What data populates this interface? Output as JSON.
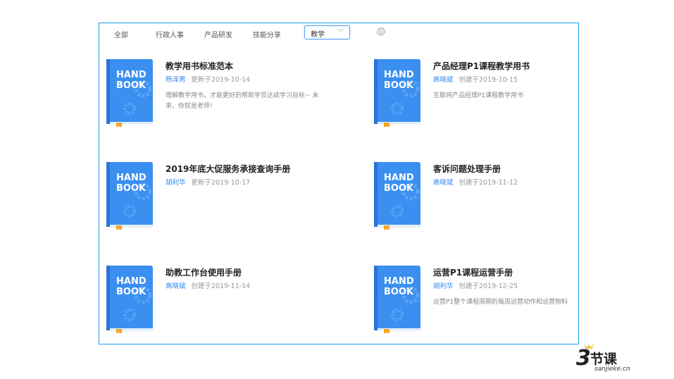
{
  "nav": {
    "tabs": [
      "全部",
      "行政人事",
      "产品研发",
      "技能分享"
    ],
    "select_value": "教学"
  },
  "book_cover": {
    "line1": "HAND",
    "line2": "BOOK"
  },
  "colors": {
    "accent": "#2f86f0",
    "border": "#1a9cf0",
    "book": "#3a8ff0",
    "bookmark": "#f5a623"
  },
  "cards": [
    {
      "title": "教学用书标准范本",
      "author": "杨泽男",
      "date": "更新于2019-10-14",
      "desc": "理解教学用书，才能更好的帮助学员达成学习目标~ 未来，你就是老师!"
    },
    {
      "title": "产品经理P1课程教学用书",
      "author": "高晓斌",
      "date": "创建于2019-10-15",
      "desc": "互联网产品经理P1课程教学用书"
    },
    {
      "title": "2019年底大促服务承接查询手册",
      "author": "胡利华",
      "date": "更新于2019-10-17",
      "desc": ""
    },
    {
      "title": "客诉问题处理手册",
      "author": "高晓斌",
      "date": "创建于2019-11-12",
      "desc": ""
    },
    {
      "title": "助教工作台使用手册",
      "author": "高晓斌",
      "date": "创建于2019-11-14",
      "desc": ""
    },
    {
      "title": "运营P1课程运营手册",
      "author": "胡利华",
      "date": "创建于2019-12-25",
      "desc": "运营P1整个课程周期的每周运营动作和运营物料"
    }
  ],
  "watermark": {
    "brand": "3节课",
    "url": "sanjieke.cn"
  }
}
